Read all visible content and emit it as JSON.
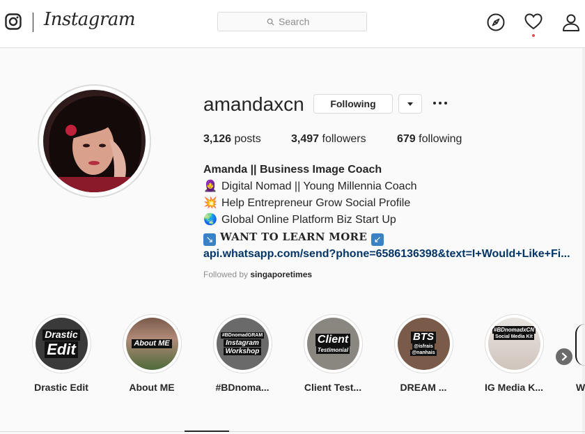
{
  "header": {
    "brand": "Instagram",
    "search_placeholder": "Search",
    "icons": [
      "instagram-glyph-icon",
      "search-icon",
      "compass-icon",
      "heart-icon",
      "person-icon"
    ],
    "notification_color": "#ed4956"
  },
  "profile": {
    "username": "amandaxcn",
    "following_label": "Following",
    "stats": {
      "posts_count": "3,126",
      "posts_label": "posts",
      "followers_count": "3,497",
      "followers_label": "followers",
      "following_count": "679",
      "following_label": "following"
    },
    "bio": {
      "name": "Amanda || Business Image Coach",
      "line1_emoji": "🧕",
      "line1": "Digital Nomad || Young Millennia Coach",
      "line2_emoji": "💥",
      "line2": "Help Entrepreneur Grow Social Profile",
      "line3_emoji": "🌏",
      "line3": "Global Online Platform Biz Start Up",
      "line4_emoji_left": "↘",
      "line4": "WANT TO LEARN MORE",
      "line4_emoji_right": "↙",
      "link": "api.whatsapp.com/send?phone=6586136398&text=I+Would+Like+Fi..."
    },
    "followed_by_prefix": "Followed by",
    "followed_by_user": "singaporetimes"
  },
  "highlights": [
    {
      "label": "Drastic Edit",
      "art_line1": "Drastic",
      "art_line2": "Edit"
    },
    {
      "label": "About ME",
      "art_line1": "About ME"
    },
    {
      "label": "#BDnoma...",
      "art_line1": "#BDnomadGRAM",
      "art_line2": "Instagram",
      "art_line3": "Workshop"
    },
    {
      "label": "Client Test...",
      "art_line1": "Client",
      "art_line2": "Testimonial"
    },
    {
      "label": "DREAM ...",
      "art_line1": "BTS",
      "art_line2": "@isfrais",
      "art_line3": "@nanhais"
    },
    {
      "label": "IG Media K...",
      "art_line1": "#BDnomadxCN",
      "art_line2": "Social Media Kit"
    }
  ],
  "partial_highlight_label": "W"
}
